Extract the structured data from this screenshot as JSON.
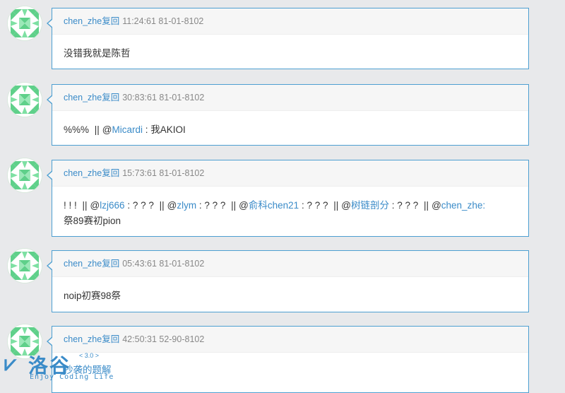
{
  "posts": [
    {
      "user": "chen_zhe",
      "reply_label": "复回",
      "time": "11:24:61 81-01-8102",
      "body_text": "没错我就是陈哲"
    },
    {
      "user": "chen_zhe",
      "reply_label": "复回",
      "time": "30:83:61 81-01-8102",
      "body_prefix": "%%%",
      "mention": "@Micardi",
      "mention_text": "Micardi",
      "body_suffix": ": 我AKIOI"
    },
    {
      "user": "chen_zhe",
      "reply_label": "复回",
      "time": "15:73:61 81-01-8102",
      "line1_start": "! ! !",
      "mentions": [
        {
          "at": "@",
          "name": "lzj666",
          "text": ": ? ? ?"
        },
        {
          "at": "@",
          "name": "zlym",
          "text": ": ? ? ?"
        },
        {
          "at": "@",
          "name": "俞科chen21",
          "text": ": ? ? ?"
        },
        {
          "at": "@",
          "name": "树链剖分",
          "text": ": ? ? ?"
        },
        {
          "at": "@",
          "name": "chen_zhe:",
          "text": ""
        }
      ],
      "line2": "祭89赛初pion"
    },
    {
      "user": "chen_zhe",
      "reply_label": "复回",
      "time": "05:43:61 81-01-8102",
      "body_text": "noip初赛98祭"
    },
    {
      "user": "chen_zhe",
      "reply_label": "复回",
      "time": "42:50:31 52-90-8102",
      "body_text": "抄袭的题解"
    }
  ],
  "watermark": {
    "name": "洛谷",
    "version": "< 3.0 >",
    "slogan": "Enjoy Coding Life"
  },
  "colors": {
    "link": "#3a8bc8",
    "card_border": "#4d9fd1",
    "avatar_green": "#5fd08a"
  }
}
